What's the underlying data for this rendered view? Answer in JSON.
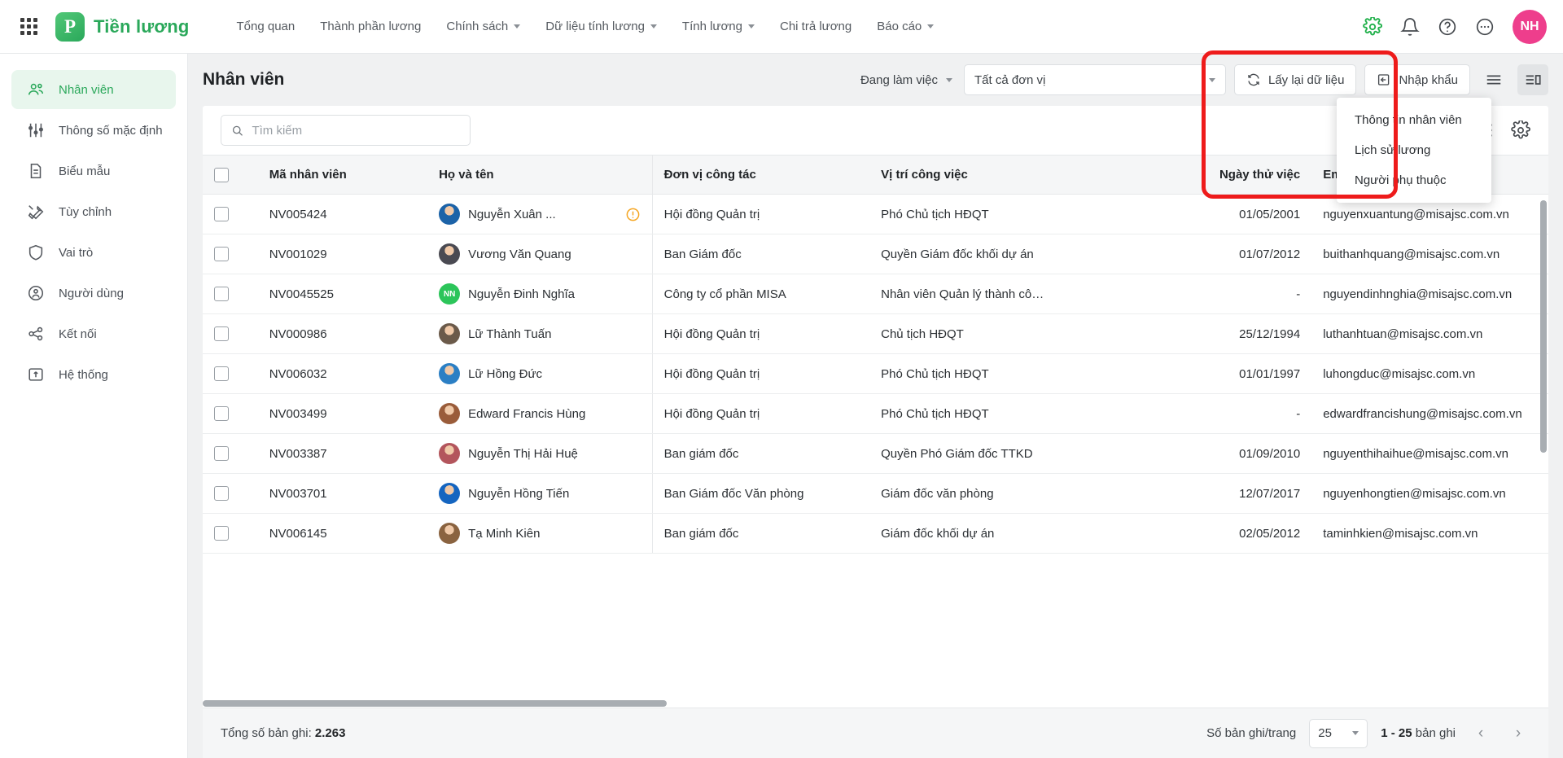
{
  "app": {
    "brand_name": "Tiền lương",
    "brand_initial": "P",
    "avatar_initials": "NH"
  },
  "topnav": {
    "items": [
      {
        "label": "Tổng quan",
        "has_caret": false
      },
      {
        "label": "Thành phần lương",
        "has_caret": false
      },
      {
        "label": "Chính sách",
        "has_caret": true
      },
      {
        "label": "Dữ liệu tính lương",
        "has_caret": true
      },
      {
        "label": "Tính lương",
        "has_caret": true
      },
      {
        "label": "Chi trả lương",
        "has_caret": false
      },
      {
        "label": "Báo cáo",
        "has_caret": true
      }
    ],
    "icons": [
      "settings-icon",
      "bell-icon",
      "help-icon",
      "more-icon"
    ]
  },
  "sidebar": {
    "items": [
      {
        "label": "Nhân viên",
        "icon": "people-icon",
        "active": true
      },
      {
        "label": "Thông số mặc định",
        "icon": "sliders-icon",
        "active": false
      },
      {
        "label": "Biểu mẫu",
        "icon": "document-icon",
        "active": false
      },
      {
        "label": "Tùy chỉnh",
        "icon": "tools-icon",
        "active": false
      },
      {
        "label": "Vai trò",
        "icon": "shield-icon",
        "active": false
      },
      {
        "label": "Người dùng",
        "icon": "user-circle-icon",
        "active": false
      },
      {
        "label": "Kết nối",
        "icon": "share-icon",
        "active": false
      },
      {
        "label": "Hệ thống",
        "icon": "system-icon",
        "active": false
      }
    ]
  },
  "page": {
    "title": "Nhân viên",
    "status_filter": "Đang làm việc",
    "unit_filter": "Tất cả đơn vị",
    "refresh_button": "Lấy lại dữ liệu",
    "import_button": "Nhập khẩu"
  },
  "import_menu": {
    "items": [
      "Thông tin nhân viên",
      "Lịch sử lương",
      "Người phụ thuộc"
    ]
  },
  "search": {
    "placeholder": "Tìm kiếm",
    "value": ""
  },
  "table": {
    "columns": [
      "Mã nhân viên",
      "Họ và tên",
      "Đơn vị công tác",
      "Vị trí công việc",
      "Ngày thử việc",
      "Email"
    ],
    "rows": [
      {
        "code": "NV005424",
        "name": "Nguyễn Xuân ...",
        "unit": "Hội đồng Quản trị",
        "position": "Phó Chủ tịch HĐQT",
        "trial_date": "01/05/2001",
        "email": "nguyenxuantung@misajsc.com.vn",
        "avatar_type": "photo",
        "avatar_color": "#1c63a8",
        "avatar_initials": "",
        "warning": true
      },
      {
        "code": "NV001029",
        "name": "Vương Văn Quang",
        "unit": "Ban Giám đốc",
        "position": "Quyền Giám đốc khối dự án",
        "trial_date": "01/07/2012",
        "email": "buithanhquang@misajsc.com.vn",
        "avatar_type": "photo",
        "avatar_color": "#4a4a52",
        "avatar_initials": "",
        "warning": false
      },
      {
        "code": "NV0045525",
        "name": "Nguyễn Đinh Nghĩa",
        "unit": "Công ty cổ phần MISA",
        "position": "Nhân viên Quản lý thành cô…",
        "trial_date": "-",
        "email": "nguyendinhnghia@misajsc.com.vn",
        "avatar_type": "initials",
        "avatar_color": "#2cc55a",
        "avatar_initials": "NN",
        "warning": false
      },
      {
        "code": "NV000986",
        "name": "Lữ Thành Tuấn",
        "unit": "Hội đồng Quản trị",
        "position": "Chủ tịch HĐQT",
        "trial_date": "25/12/1994",
        "email": "luthanhtuan@misajsc.com.vn",
        "avatar_type": "photo",
        "avatar_color": "#6b5a4a",
        "avatar_initials": "",
        "warning": false
      },
      {
        "code": "NV006032",
        "name": "Lữ Hồng Đức",
        "unit": "Hội đồng Quản trị",
        "position": "Phó Chủ tịch HĐQT",
        "trial_date": "01/01/1997",
        "email": "luhongduc@misajsc.com.vn",
        "avatar_type": "photo",
        "avatar_color": "#2b7fc4",
        "avatar_initials": "",
        "warning": false
      },
      {
        "code": "NV003499",
        "name": "Edward Francis Hùng",
        "unit": "Hội đồng Quản trị",
        "position": "Phó Chủ tịch HĐQT",
        "trial_date": "-",
        "email": "edwardfrancishung@misajsc.com.vn",
        "avatar_type": "photo",
        "avatar_color": "#9a5c3a",
        "avatar_initials": "",
        "warning": false
      },
      {
        "code": "NV003387",
        "name": "Nguyễn Thị Hải Huệ",
        "unit": "Ban giám đốc",
        "position": "Quyền Phó Giám đốc TTKD",
        "trial_date": "01/09/2010",
        "email": "nguyenthihaihue@misajsc.com.vn",
        "avatar_type": "photo",
        "avatar_color": "#b3555c",
        "avatar_initials": "",
        "warning": false
      },
      {
        "code": "NV003701",
        "name": "Nguyễn Hồng Tiến",
        "unit": "Ban Giám đốc Văn phòng",
        "position": "Giám đốc văn phòng",
        "trial_date": "12/07/2017",
        "email": "nguyenhongtien@misajsc.com.vn",
        "avatar_type": "photo",
        "avatar_color": "#1565c0",
        "avatar_initials": "",
        "warning": false
      },
      {
        "code": "NV006145",
        "name": "Tạ Minh Kiên",
        "unit": "Ban giám đốc",
        "position": "Giám đốc khối dự án",
        "trial_date": "02/05/2012",
        "email": "taminhkien@misajsc.com.vn",
        "avatar_type": "photo",
        "avatar_color": "#8a6340",
        "avatar_initials": "",
        "warning": false
      }
    ]
  },
  "footer": {
    "total_label": "Tổng số bản ghi:",
    "total_value": "2.263",
    "per_page_label": "Số bản ghi/trang",
    "per_page_value": "25",
    "range_bold": "1 - 25",
    "range_suffix": "bản ghi"
  },
  "colors": {
    "brand_green": "#2aa85a",
    "avatar_pink": "#ee3e8c",
    "annotation_red": "#ee1b1b",
    "warning_orange": "#f5a623"
  }
}
